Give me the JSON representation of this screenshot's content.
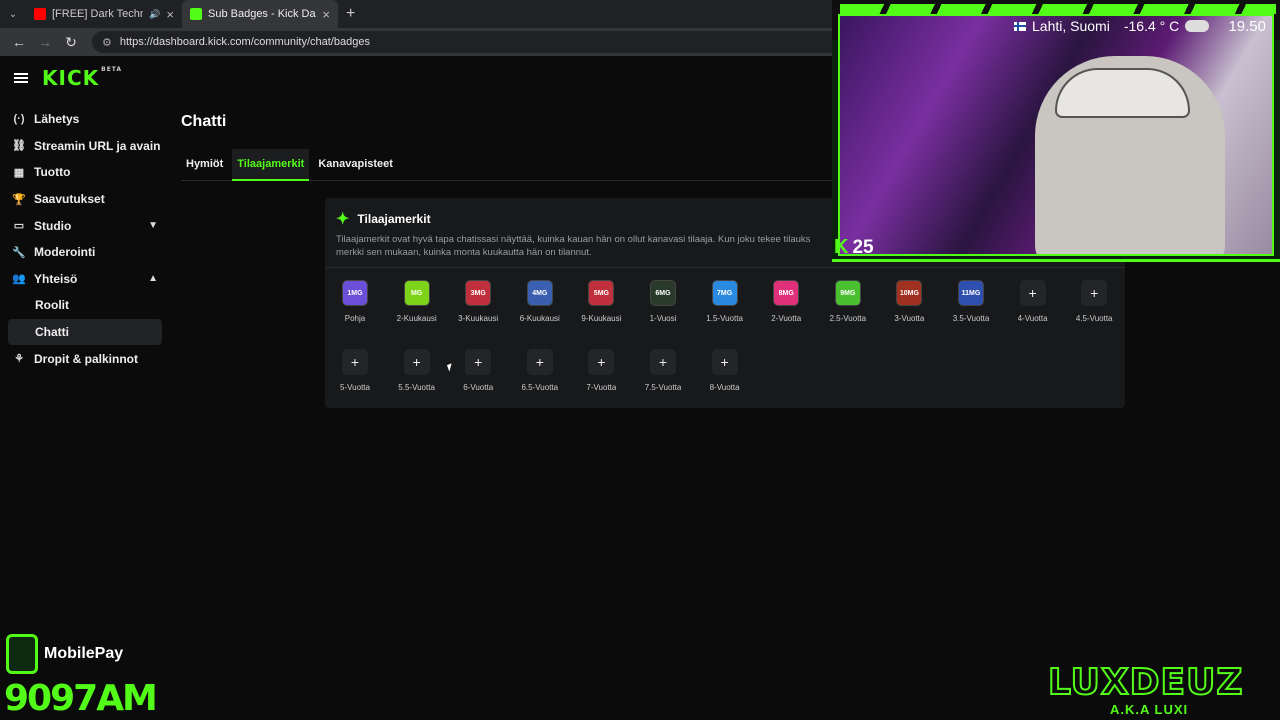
{
  "browser": {
    "tabs": [
      {
        "title": "[FREE] Dark Techno Urban",
        "favicon_color": "#ff0000"
      },
      {
        "title": "Sub Badges - Kick Dashboard",
        "favicon_color": "#53fc18"
      }
    ],
    "url": "https://dashboard.kick.com/community/chat/badges"
  },
  "app": {
    "logo": "KICK",
    "logo_sup": "BETA",
    "accent": "#53fc18"
  },
  "sidebar": {
    "items": [
      {
        "label": "Lähetys",
        "icon": "(·)"
      },
      {
        "label": "Streamin URL ja avain",
        "icon": "⛓"
      },
      {
        "label": "Tuotto",
        "icon": "▦"
      },
      {
        "label": "Saavutukset",
        "icon": "🏆"
      },
      {
        "label": "Studio",
        "icon": "▭"
      },
      {
        "label": "Moderointi",
        "icon": "🔧"
      },
      {
        "label": "Yhteisö",
        "icon": "👥"
      },
      {
        "label": "Roolit"
      },
      {
        "label": "Chatti"
      },
      {
        "label": "Dropit & palkinnot",
        "icon": "⚘"
      }
    ]
  },
  "page": {
    "title": "Chatti",
    "tabs": [
      "Hymiöt",
      "Tilaajamerkit",
      "Kanavapisteet"
    ],
    "card_title": "Tilaajamerkit",
    "card_desc": "Tilaajamerkit ovat hyvä tapa chatissasi näyttää, kuinka kauan hän on ollut kanavasi tilaaja. Kun joku tekee tilauks merkki sen mukaan, kuinka monta kuukautta hän on tilannut."
  },
  "badges": [
    {
      "label": "Pohja",
      "text": "1MG",
      "color": "#6b4fd8"
    },
    {
      "label": "2-Kuukausi",
      "text": "MG",
      "color": "#7dd31a"
    },
    {
      "label": "3-Kuukausi",
      "text": "3MG",
      "color": "#c0303c"
    },
    {
      "label": "6-Kuukausi",
      "text": "4MG",
      "color": "#3a5fb0"
    },
    {
      "label": "9-Kuukausi",
      "text": "5MG",
      "color": "#c0303c"
    },
    {
      "label": "1-Vuosi",
      "text": "6MG",
      "color": "#2a3a2a"
    },
    {
      "label": "1.5-Vuotta",
      "text": "7MG",
      "color": "#2a8ae0"
    },
    {
      "label": "2-Vuotta",
      "text": "8MG",
      "color": "#e0307a"
    },
    {
      "label": "2.5-Vuotta",
      "text": "9MG",
      "color": "#4ac030"
    },
    {
      "label": "3-Vuotta",
      "text": "10MG",
      "color": "#a03020"
    },
    {
      "label": "3.5-Vuotta",
      "text": "11MG",
      "color": "#3050b0"
    },
    {
      "label": "4-Vuotta",
      "text": "+"
    },
    {
      "label": "4.5-Vuotta",
      "text": "+"
    },
    {
      "label": "5-Vuotta",
      "text": "+"
    },
    {
      "label": "5.5-Vuotta",
      "text": "+"
    },
    {
      "label": "6-Vuotta",
      "text": "+"
    },
    {
      "label": "6.5-Vuotta",
      "text": "+"
    },
    {
      "label": "7-Vuotta",
      "text": "+"
    },
    {
      "label": "7.5-Vuotta",
      "text": "+"
    },
    {
      "label": "8-Vuotta",
      "text": "+"
    }
  ],
  "overlay": {
    "location": "Lahti, Suomi",
    "temperature": "-16.4 ° C",
    "clock": "19.50",
    "kick_count": "25",
    "mobilepay_label": "MobilePay",
    "mobilepay_number": "9097AM",
    "brand": "LUXDEUZ",
    "brand_sub": "A.K.A LUXI"
  }
}
